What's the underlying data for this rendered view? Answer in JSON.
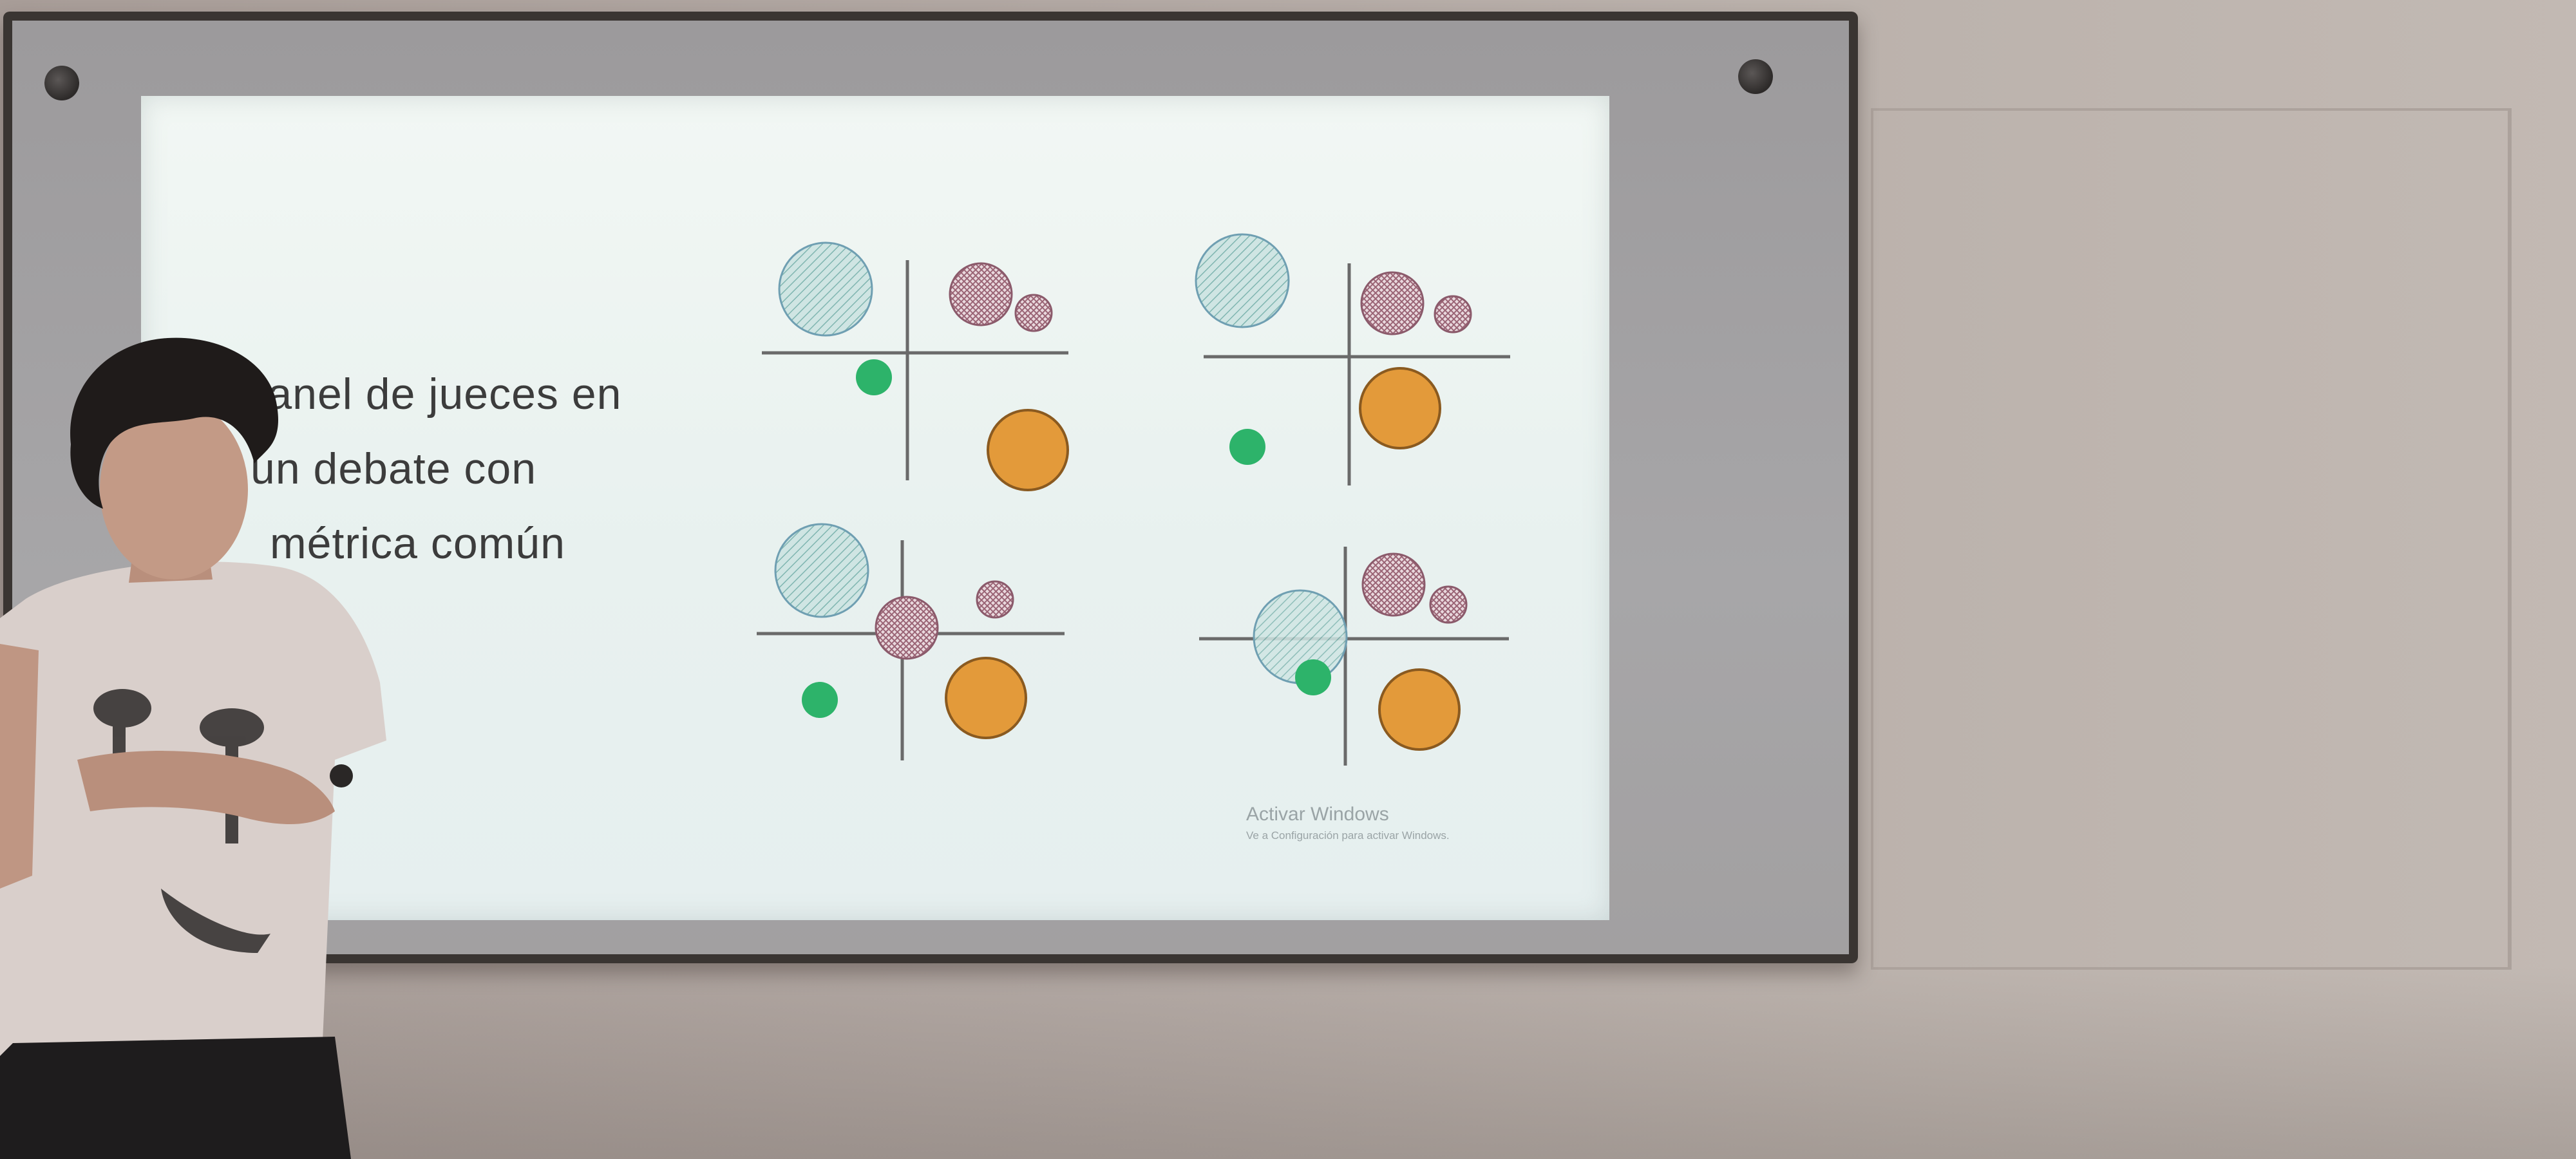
{
  "slide": {
    "title_lines": [
      "Panel de jueces en",
      "un debate con",
      "métrica común"
    ]
  },
  "watermark": {
    "line1": "Activar Windows",
    "line2": "Ve a Configuración para activar Windows."
  },
  "colors": {
    "hatched_blue": "#9fc9c6",
    "hatched_maroon": "#b08a98",
    "green": "#2db36a",
    "orange": "#e39a3a",
    "board_frame": "#3a3532"
  },
  "diagrams_count": 4
}
